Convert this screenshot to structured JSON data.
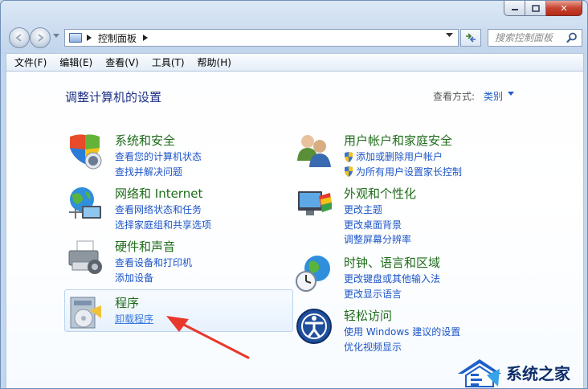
{
  "window": {
    "caption": {
      "close_glyph": "✕"
    }
  },
  "navbar": {
    "address_path": "控制面板",
    "search_placeholder": "搜索控制面板"
  },
  "menubar": {
    "items": [
      "文件(F)",
      "编辑(E)",
      "查看(V)",
      "工具(T)",
      "帮助(H)"
    ]
  },
  "content": {
    "title": "调整计算机的设置",
    "view_by_label": "查看方式:",
    "view_by_value": "类别"
  },
  "categories": [
    {
      "id": "system-security",
      "icon": "shield-icon",
      "title": "系统和安全",
      "links": [
        "查看您的计算机状态",
        "查找并解决问题"
      ]
    },
    {
      "id": "network-internet",
      "icon": "globe-network-icon",
      "title": "网络和 Internet",
      "links": [
        "查看网络状态和任务",
        "选择家庭组和共享选项"
      ]
    },
    {
      "id": "hardware-sound",
      "icon": "printer-icon",
      "title": "硬件和声音",
      "links": [
        "查看设备和打印机",
        "添加设备"
      ]
    },
    {
      "id": "programs",
      "icon": "programs-icon",
      "title": "程序",
      "links": [
        "卸载程序"
      ],
      "highlighted": true
    },
    {
      "id": "user-accounts",
      "icon": "users-icon",
      "title": "用户帐户和家庭安全",
      "links": [
        "添加或删除用户帐户",
        "为所有用户设置家长控制"
      ]
    },
    {
      "id": "appearance",
      "icon": "monitor-palette-icon",
      "title": "外观和个性化",
      "links": [
        "更改主题",
        "更改桌面背景",
        "调整屏幕分辨率"
      ]
    },
    {
      "id": "clock-language",
      "icon": "clock-globe-icon",
      "title": "时钟、语言和区域",
      "links": [
        "更改键盘或其他输入法",
        "更改显示语言"
      ]
    },
    {
      "id": "ease-of-access",
      "icon": "ease-of-access-icon",
      "title": "轻松访问",
      "links": [
        "使用 Windows 建议的设置",
        "优化视频显示"
      ]
    }
  ],
  "watermark": {
    "text": "系统之家"
  },
  "colors": {
    "title": "#1e3287",
    "category": "#1f6b1a",
    "link": "#1d55c7",
    "arrow": "#e8382c"
  }
}
